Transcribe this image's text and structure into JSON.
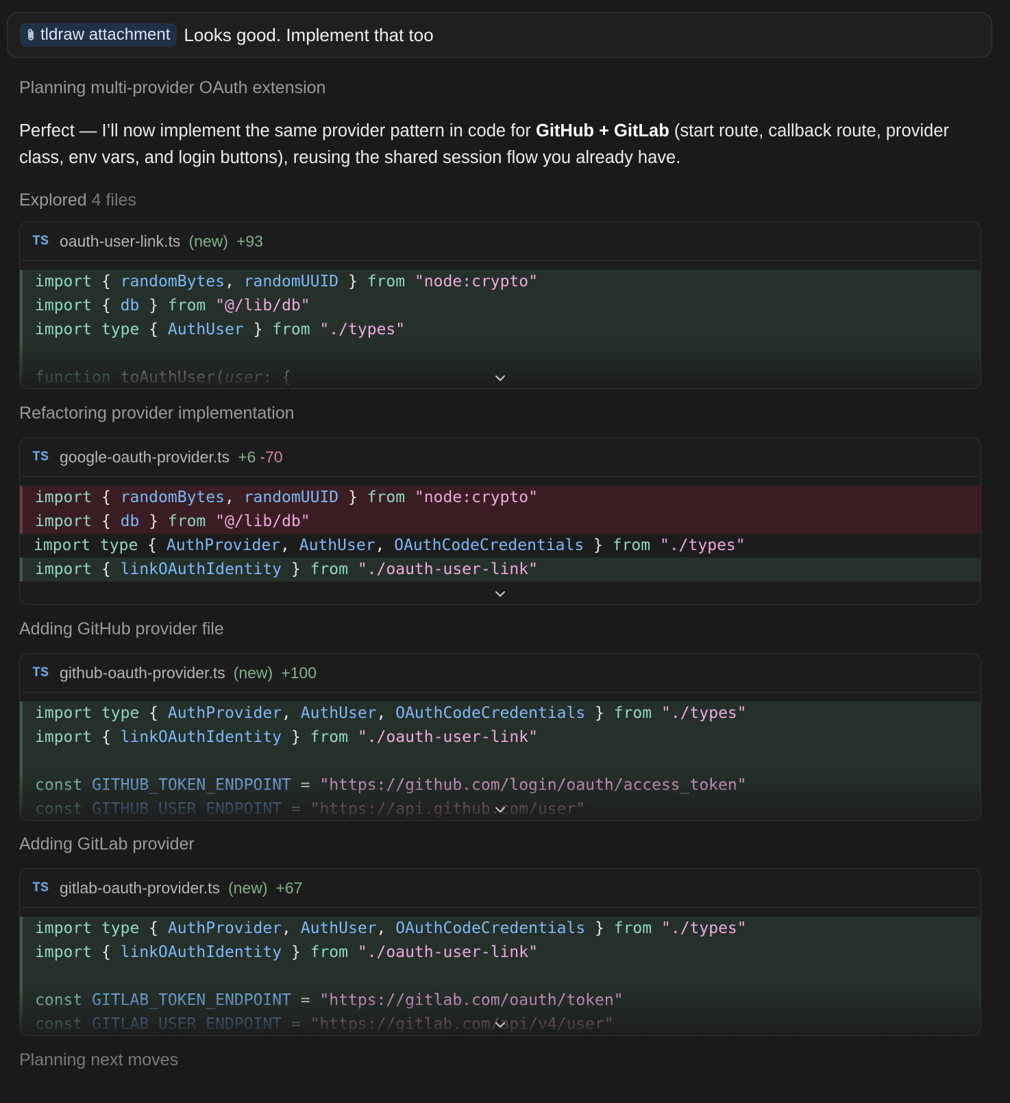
{
  "user_message": {
    "attachment_label": "tldraw attachment",
    "attachment_icon": "paperclip-icon",
    "text": "Looks good. Implement that too"
  },
  "steps": {
    "planning": "Planning multi-provider OAuth extension",
    "refactoring": "Refactoring provider implementation",
    "adding_github": "Adding GitHub provider file",
    "adding_gitlab": "Adding GitLab provider",
    "next": "Planning next moves"
  },
  "paragraph": {
    "part1": "Perfect — I’ll now implement the same provider pattern in code for ",
    "bold": "GitHub + GitLab",
    "part2": " (start route, callback route, provider class, env vars, and login buttons), reusing the shared session flow you already have."
  },
  "explored": {
    "label": "Explored",
    "count": "4 files"
  },
  "diffs": [
    {
      "badge": "TS",
      "file": "oauth-user-link.ts",
      "new_tag": "(new)",
      "added": "+93",
      "removed": ""
    },
    {
      "badge": "TS",
      "file": "google-oauth-provider.ts",
      "new_tag": "",
      "added": "+6",
      "removed": "-70"
    },
    {
      "badge": "TS",
      "file": "github-oauth-provider.ts",
      "new_tag": "(new)",
      "added": "+100",
      "removed": ""
    },
    {
      "badge": "TS",
      "file": "gitlab-oauth-provider.ts",
      "new_tag": "(new)",
      "added": "+67",
      "removed": ""
    }
  ],
  "colors": {
    "added_line_bg": "#25302a",
    "removed_line_bg": "#3a1d22",
    "keyword": "#8fd7c3",
    "identifier": "#7cb8f7",
    "string": "#f0a8df"
  }
}
